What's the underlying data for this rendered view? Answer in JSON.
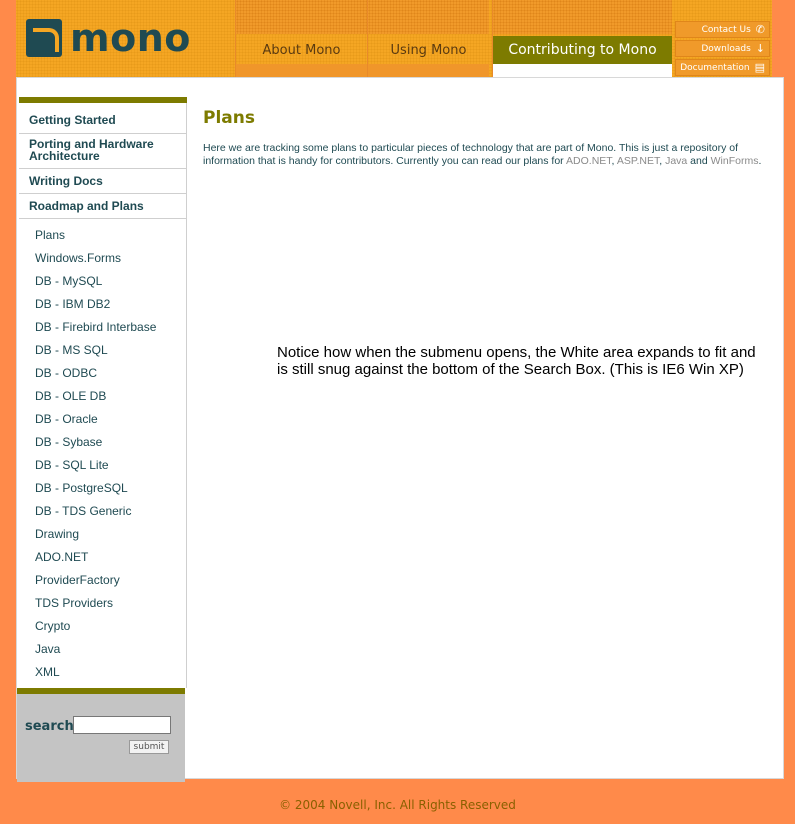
{
  "header": {
    "logo_text": "mono",
    "tabs": [
      {
        "label": "About Mono"
      },
      {
        "label": "Using Mono"
      },
      {
        "label": "Contributing to Mono"
      }
    ],
    "utility": [
      {
        "label": "Contact Us",
        "icon": "phone-icon"
      },
      {
        "label": "Downloads",
        "icon": "download-arrow-icon"
      },
      {
        "label": "Documentation",
        "icon": "document-icon"
      }
    ]
  },
  "sidebar": {
    "top_items": [
      {
        "label": "Getting Started"
      },
      {
        "label": "Porting and Hardware Architecture"
      },
      {
        "label": "Writing Docs"
      },
      {
        "label": "Roadmap and Plans"
      }
    ],
    "sub_items": [
      "Plans",
      "Windows.Forms",
      "DB - MySQL",
      "DB - IBM DB2",
      "DB - Firebird Interbase",
      "DB - MS SQL",
      "DB - ODBC",
      "DB - OLE DB",
      "DB - Oracle",
      "DB - Sybase",
      "DB - SQL Lite",
      "DB - PostgreSQL",
      "DB - TDS Generic",
      "Drawing",
      "ADO.NET",
      "ProviderFactory",
      "TDS Providers",
      "Crypto",
      "Java",
      "XML"
    ]
  },
  "search": {
    "label": "search",
    "value": "",
    "submit_label": "submit"
  },
  "content": {
    "title": "Plans",
    "intro_before": "Here we are tracking some plans to particular pieces of technology that are part of Mono. This is just a repository of information that is handy for contributors. Currently you can read our plans for ",
    "links": [
      "ADO.NET",
      "ASP.NET",
      "Java",
      "WinForms"
    ],
    "sep1": ", ",
    "sep2": ", ",
    "sep3": " and ",
    "intro_end": ".",
    "note": "Notice how when the submenu opens, the White area expands to fit and is still snug against the bottom of the Search Box.  (This is IE6 Win XP)"
  },
  "footer": {
    "text": "© 2004 Novell, Inc. All Rights Reserved"
  },
  "colors": {
    "page_bg": "#ff8a4a",
    "header_bg": "#f5a623",
    "accent_olive": "#7d7b00",
    "text_teal": "#1f4a52"
  }
}
